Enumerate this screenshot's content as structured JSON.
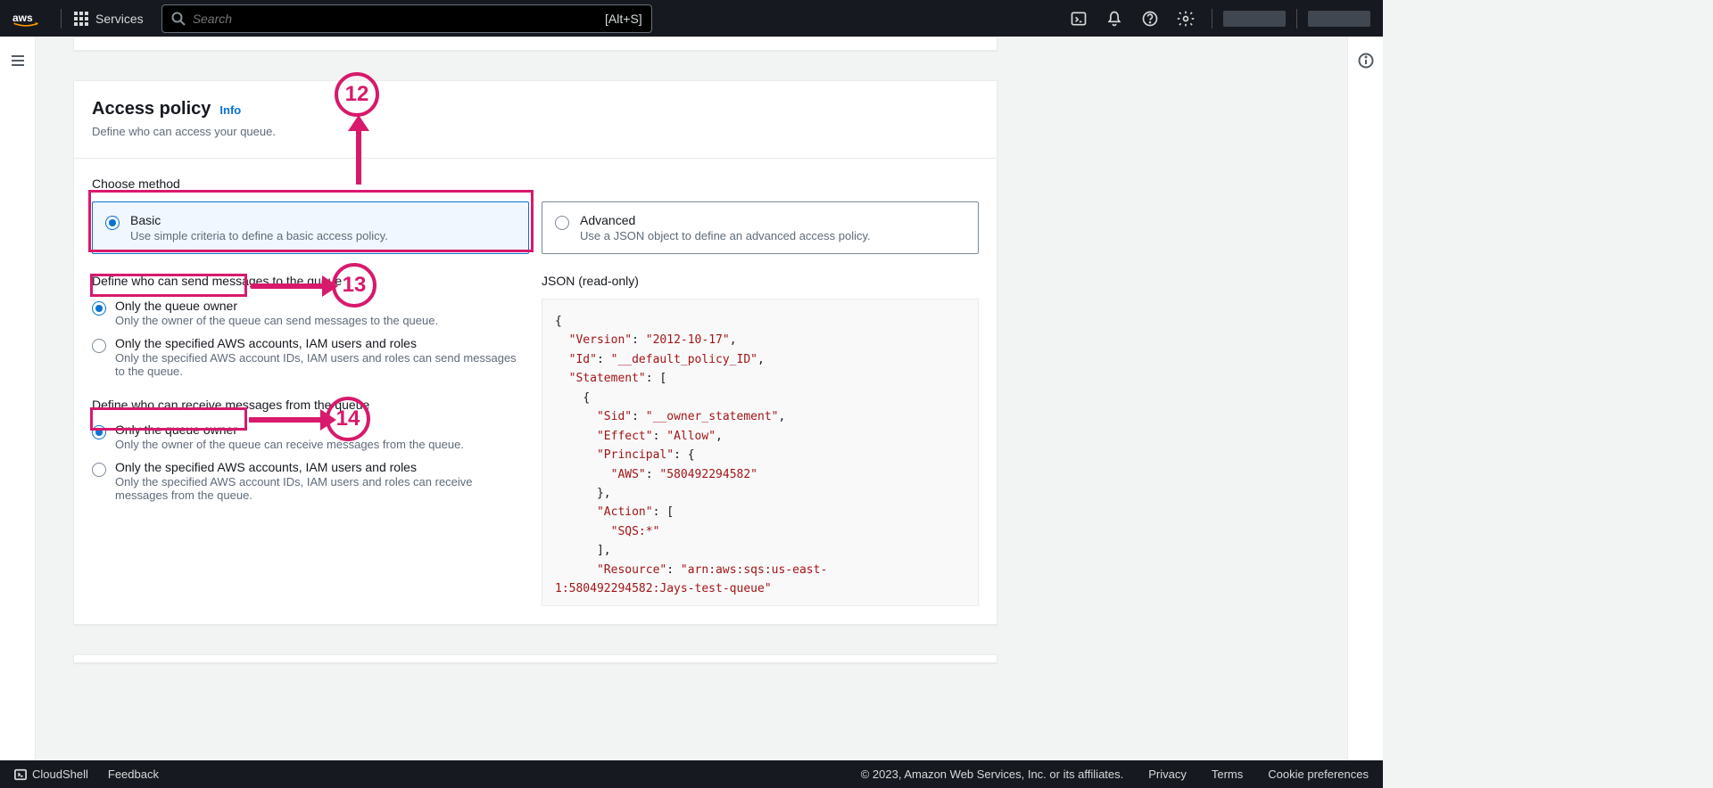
{
  "header": {
    "services": "Services",
    "searchPlaceholder": "Search",
    "searchShortcut": "[Alt+S]"
  },
  "panel": {
    "title": "Access policy",
    "info": "Info",
    "description": "Define who can access your queue.",
    "chooseMethod": "Choose method",
    "basic": {
      "title": "Basic",
      "desc": "Use simple criteria to define a basic access policy."
    },
    "advanced": {
      "title": "Advanced",
      "desc": "Use a JSON object to define an advanced access policy."
    },
    "send": {
      "label": "Define who can send messages to the queue",
      "ownerTitle": "Only the queue owner",
      "ownerDesc": "Only the owner of the queue can send messages to the queue.",
      "specifiedTitle": "Only the specified AWS accounts, IAM users and roles",
      "specifiedDesc": "Only the specified AWS account IDs, IAM users and roles can send messages to the queue."
    },
    "receive": {
      "label": "Define who can receive messages from the queue",
      "ownerTitle": "Only the queue owner",
      "ownerDesc": "Only the owner of the queue can receive messages from the queue.",
      "specifiedTitle": "Only the specified AWS accounts, IAM users and roles",
      "specifiedDesc": "Only the specified AWS account IDs, IAM users and roles can receive messages from the queue."
    },
    "jsonLabel": "JSON (read-only)",
    "json": {
      "Version": "2012-10-17",
      "Id": "__default_policy_ID",
      "Sid": "__owner_statement",
      "Effect": "Allow",
      "AWS": "580492294582",
      "Action": "SQS:*",
      "Resource": "arn:aws:sqs:us-east-1:580492294582:Jays-test-queue"
    }
  },
  "annotations": {
    "n12": "12",
    "n13": "13",
    "n14": "14"
  },
  "footer": {
    "cloudshell": "CloudShell",
    "feedback": "Feedback",
    "copyright": "© 2023, Amazon Web Services, Inc. or its affiliates.",
    "privacy": "Privacy",
    "terms": "Terms",
    "cookies": "Cookie preferences"
  }
}
